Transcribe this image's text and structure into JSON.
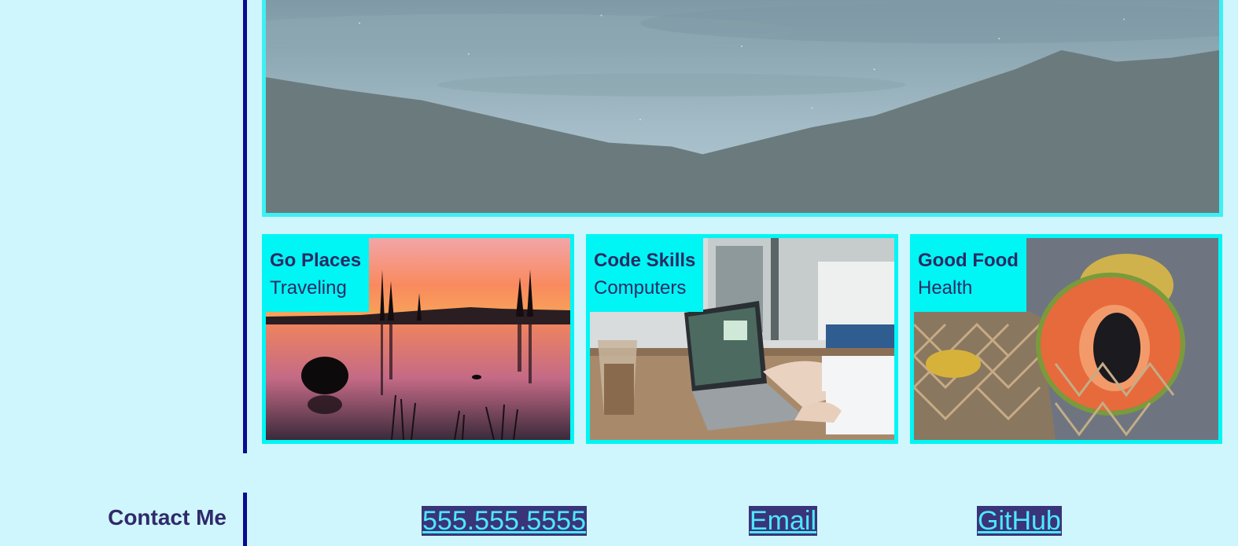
{
  "cards": [
    {
      "title": "Go Places",
      "subtitle": "Traveling",
      "image": "lake-sunset-image"
    },
    {
      "title": "Code Skills",
      "subtitle": "Computers",
      "image": "laptop-cafe-image"
    },
    {
      "title": "Good Food",
      "subtitle": "Health",
      "image": "papaya-fruit-image"
    }
  ],
  "contact": {
    "label": "Contact Me",
    "phone": "555.555.5555",
    "email": "Email",
    "github": "GitHub"
  },
  "colors": {
    "background": "#cff6fc",
    "divider": "#0a0a8f",
    "card_border": "#00f5f5",
    "link_bg": "#3a3478",
    "link_text": "#4de8ff",
    "heading_text": "#2f2a6b"
  }
}
